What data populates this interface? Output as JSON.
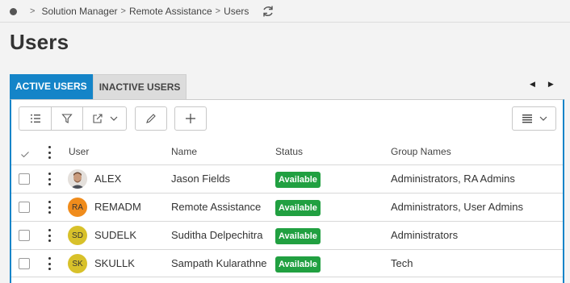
{
  "breadcrumb": {
    "items": [
      "Solution Manager",
      "Remote Assistance",
      "Users"
    ]
  },
  "page": {
    "title": "Users"
  },
  "tabs": [
    {
      "label": "ACTIVE USERS",
      "active": true
    },
    {
      "label": "INACTIVE USERS",
      "active": false
    }
  ],
  "table": {
    "columns": {
      "user": "User",
      "name": "Name",
      "status": "Status",
      "groups": "Group Names"
    },
    "rows": [
      {
        "avatar_initials": "",
        "avatar_color": "#e9e4df",
        "user": "ALEX",
        "name": "Jason Fields",
        "status": "Available",
        "groups": "Administrators, RA Admins"
      },
      {
        "avatar_initials": "RA",
        "avatar_color": "#f08c1c",
        "user": "REMADM",
        "name": "Remote Assistance",
        "status": "Available",
        "groups": "Administrators, User Admins"
      },
      {
        "avatar_initials": "SD",
        "avatar_color": "#d8c12a",
        "user": "SUDELK",
        "name": "Suditha Delpechitra",
        "status": "Available",
        "groups": "Administrators"
      },
      {
        "avatar_initials": "SK",
        "avatar_color": "#d8c12a",
        "user": "SKULLK",
        "name": "Sampath Kularathne",
        "status": "Available",
        "groups": "Tech"
      }
    ]
  },
  "colors": {
    "accent": "#1484c8",
    "status_available": "#21a041"
  },
  "icons": [
    "home-dot-icon",
    "chevron-right-icon",
    "refresh-icon",
    "list-icon",
    "filter-icon",
    "export-icon",
    "chevron-down-icon",
    "edit-icon",
    "add-icon",
    "column-view-icon",
    "check-icon",
    "kebab-icon",
    "arrow-left-icon",
    "arrow-right-icon"
  ]
}
